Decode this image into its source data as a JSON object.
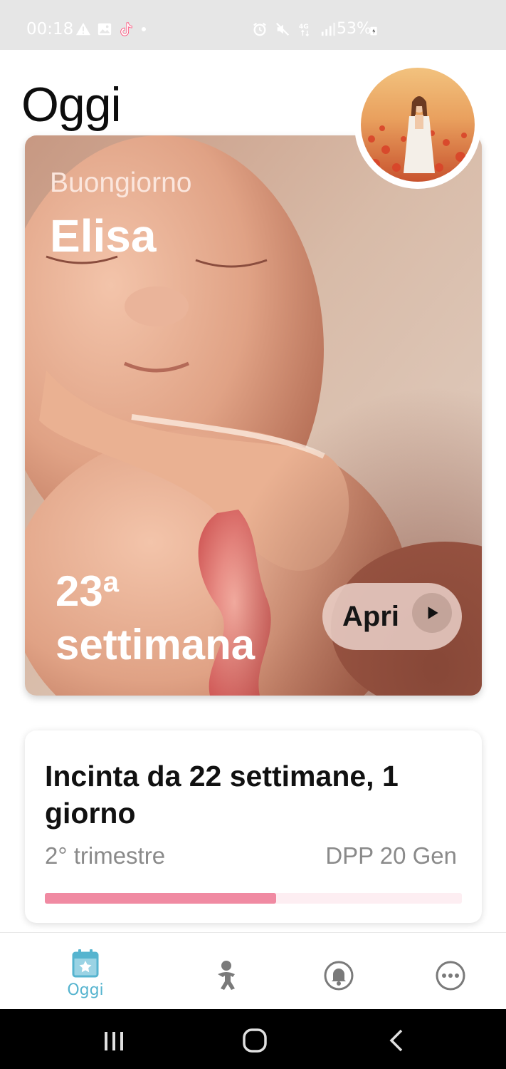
{
  "status_bar": {
    "time": "00:18",
    "battery": "53%",
    "left_icons": [
      "warning-icon",
      "image-icon",
      "tiktok-icon",
      "dot-icon"
    ],
    "right_icons": [
      "alarm-icon",
      "mute-icon",
      "4g-icon",
      "signal-icon",
      "battery-icon"
    ]
  },
  "header": {
    "title": "Oggi"
  },
  "hero": {
    "greeting": "Buongiorno",
    "name": "Elisa",
    "week_number": "23",
    "week_suffix": "a",
    "week_label": "settimana",
    "open_label": "Apri"
  },
  "progress": {
    "title": "Incinta da  22 settimane, 1 giorno",
    "trimester": "2° trimestre",
    "due_date": "DPP 20 Gen",
    "fraction": 0.555
  },
  "bottom_nav": {
    "items": [
      {
        "label": "Oggi",
        "icon": "calendar-star-icon",
        "active": true
      },
      {
        "label": "",
        "icon": "baby-icon",
        "active": false
      },
      {
        "label": "",
        "icon": "bell-icon",
        "active": false
      },
      {
        "label": "",
        "icon": "more-icon",
        "active": false
      }
    ]
  },
  "colors": {
    "accent": "#56b4cf",
    "progress_fill": "#f08aa2",
    "progress_track": "#fdeef2"
  }
}
